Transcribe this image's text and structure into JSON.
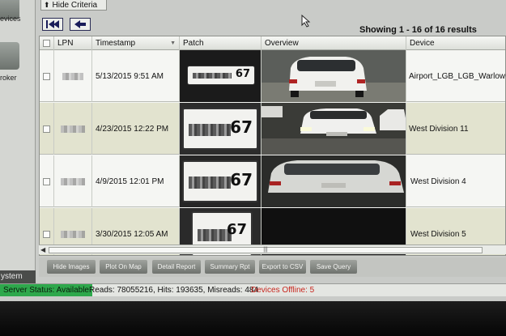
{
  "nav": {
    "items": [
      {
        "label": "evices",
        "icon": "devices-icon"
      },
      {
        "label": "roker",
        "icon": "broker-icon"
      }
    ],
    "section_label": "ystem"
  },
  "criteria_tab": {
    "label": "Hide Criteria"
  },
  "pager": {
    "showing": "Showing 1 - 16 of 16 results"
  },
  "grid": {
    "columns": [
      "LPN",
      "Timestamp",
      "Patch",
      "Overview",
      "Device"
    ],
    "rows": [
      {
        "timestamp": "5/13/2015 9:51 AM",
        "plate_digits": "67",
        "device": "Airport_LGB_LGB_Warlow"
      },
      {
        "timestamp": "4/23/2015 12:22 PM",
        "plate_digits": "67",
        "device": "West Division 11"
      },
      {
        "timestamp": "4/9/2015 12:01 PM",
        "plate_digits": "67",
        "device": "West Division 4"
      },
      {
        "timestamp": "3/30/2015 12:05 AM",
        "plate_digits": "67",
        "device": "West Division 5"
      }
    ]
  },
  "actions": [
    "Hide Images",
    "Plot On Map",
    "Detail Report",
    "Summary Rpt",
    "Export to CSV",
    "Save Query"
  ],
  "status": {
    "server": "Server Status: Available",
    "reads": "Reads: 78055216, Hits: 193635, Misreads: 484",
    "offline": "Devices Offline: 5"
  },
  "colors": {
    "status_ok": "#2ea84c",
    "offline_text": "#c8261e",
    "row_alt": "#e2e3cf"
  }
}
